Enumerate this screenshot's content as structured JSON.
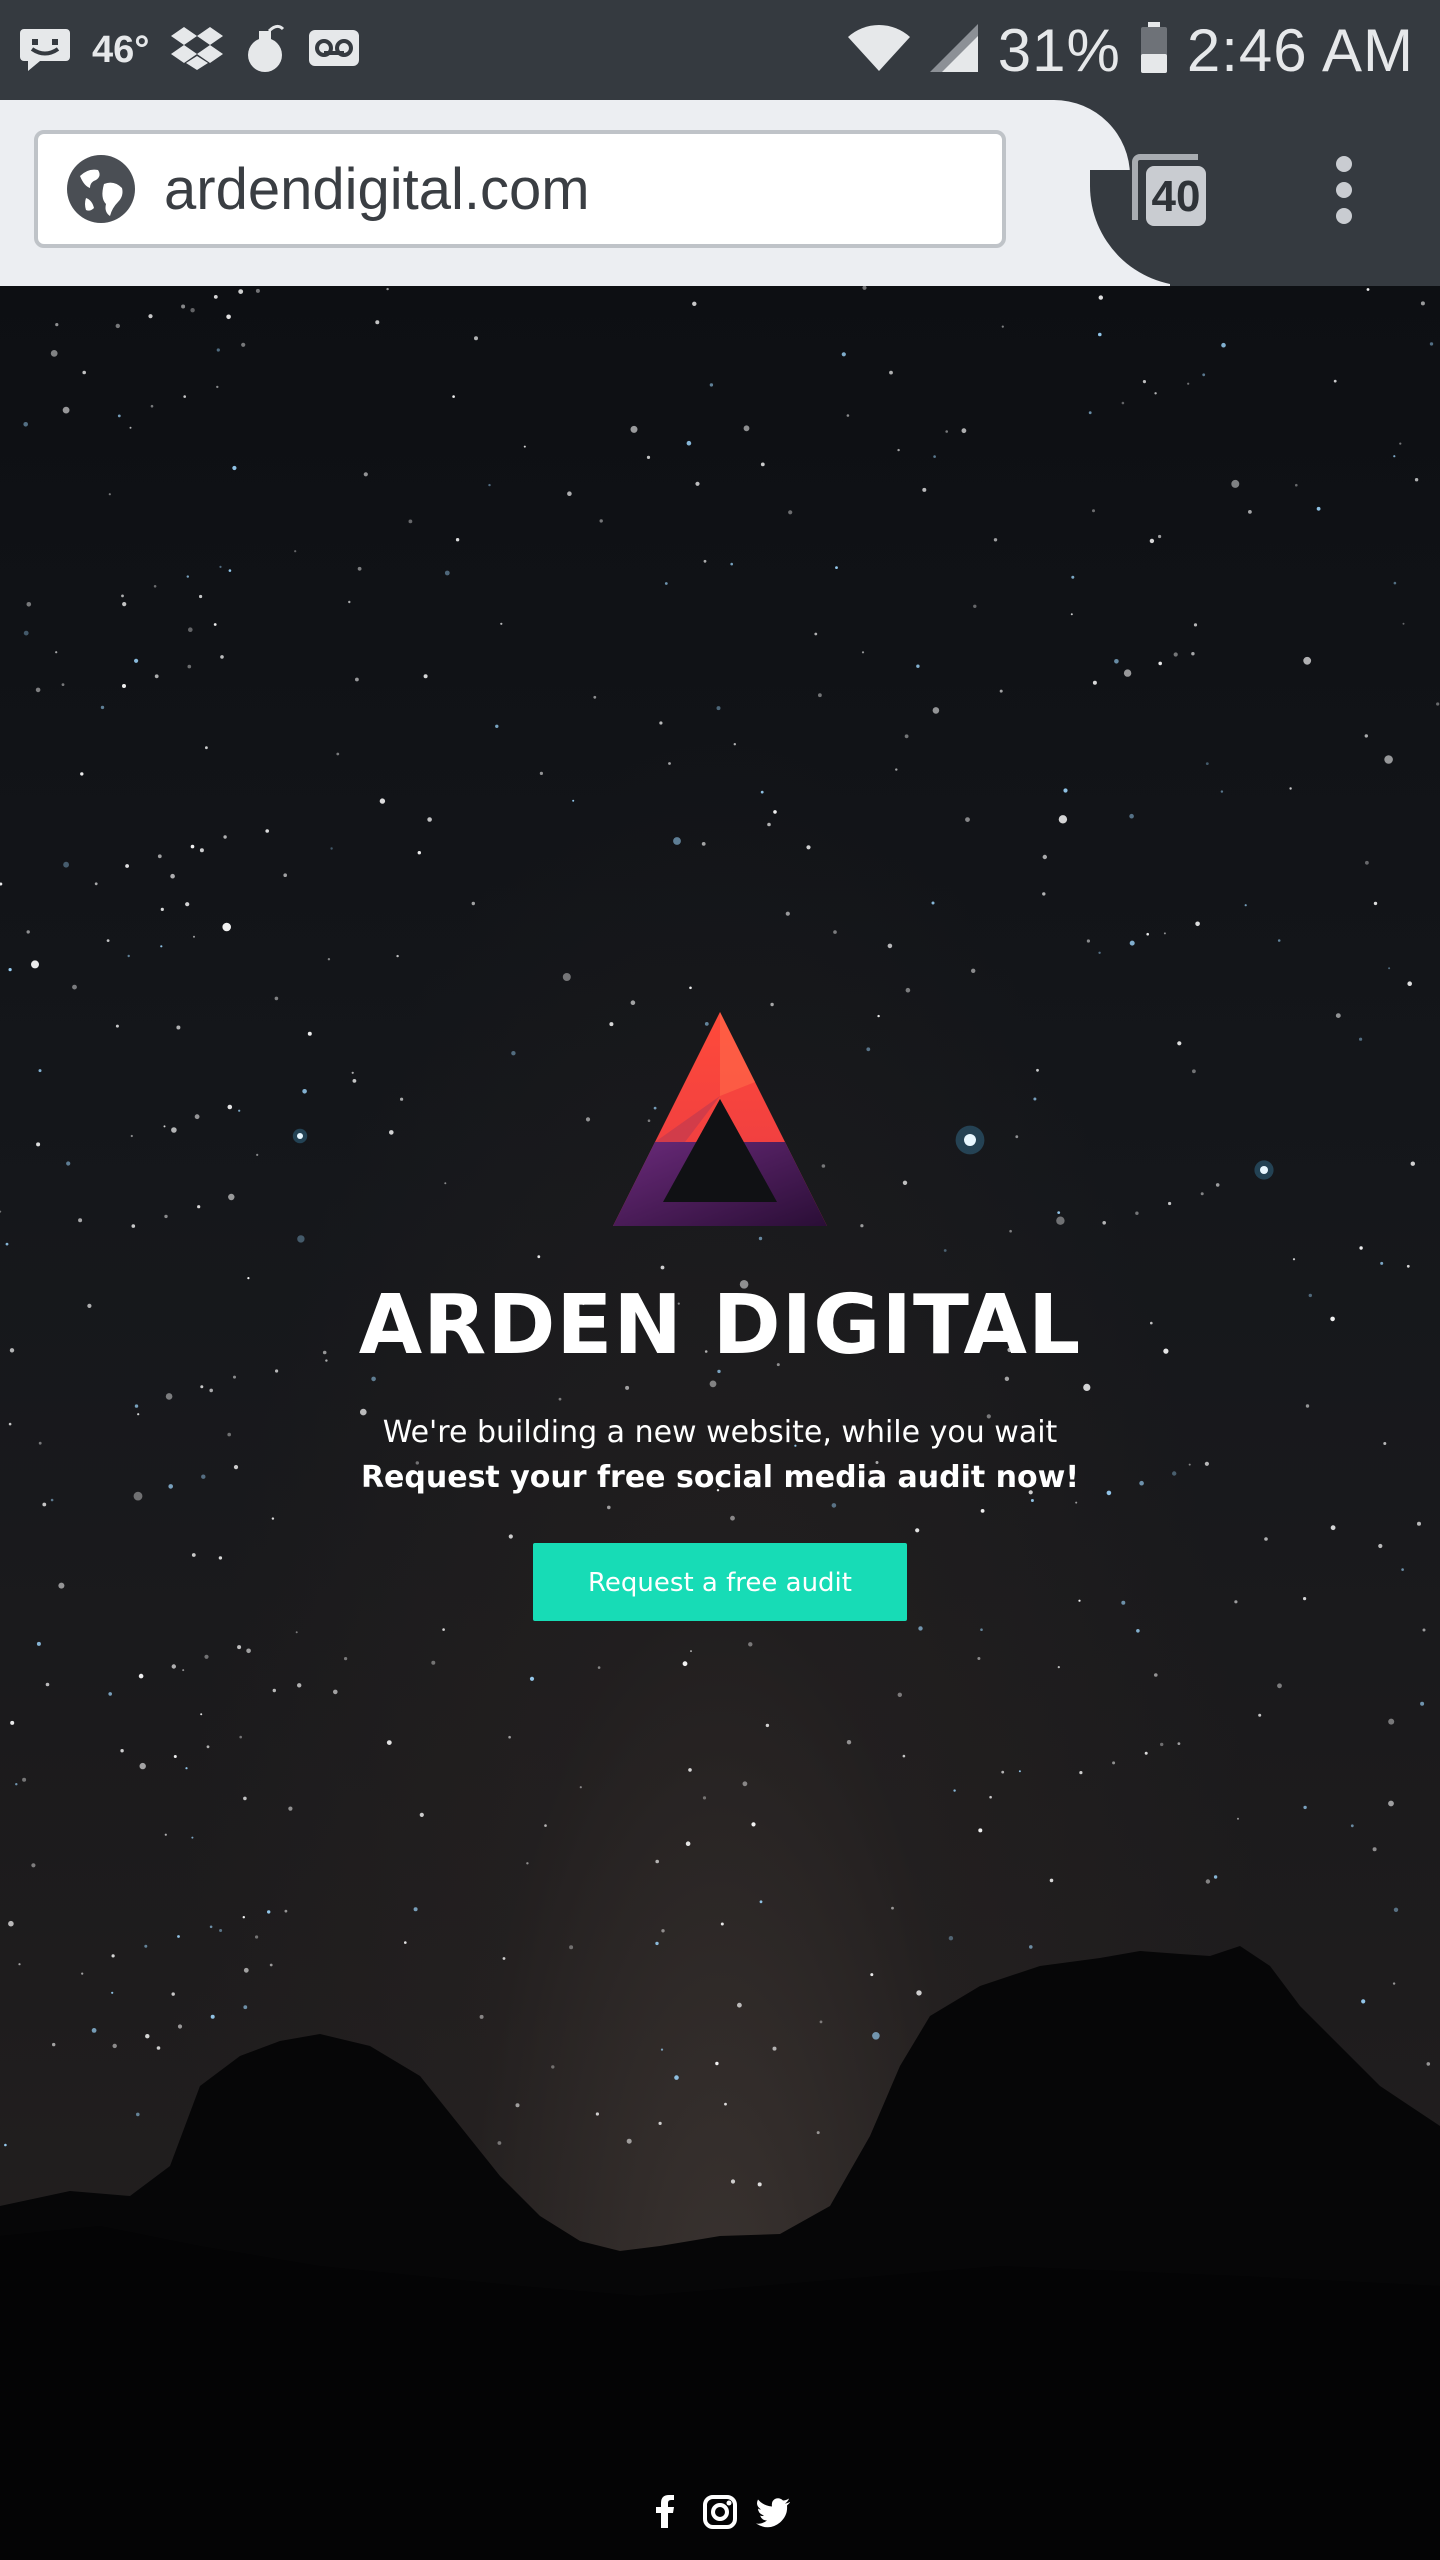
{
  "status_bar": {
    "temperature": "46°",
    "battery_percent": "31%",
    "time": "2:46 AM",
    "icons": [
      "messenger-icon",
      "dropbox-icon",
      "grenade-icon",
      "voicemail-icon",
      "wifi-icon",
      "signal-icon",
      "battery-icon"
    ]
  },
  "browser": {
    "url": "ardendigital.com",
    "tab_count": "40",
    "icons": [
      "globe-icon",
      "tabs-icon",
      "overflow-menu-icon"
    ]
  },
  "hero": {
    "brand_title": "ARDEN DIGITAL",
    "tagline": "We're building a new website, while you wait",
    "cta_text": "Request your free social media audit now!",
    "cta_button_label": "Request a free audit"
  },
  "social_links": [
    {
      "name": "facebook-icon",
      "label": "f"
    },
    {
      "name": "instagram-icon",
      "label": ""
    },
    {
      "name": "twitter-icon",
      "label": ""
    }
  ],
  "colors": {
    "status_bar_bg": "#353a40",
    "url_bar_bg": "#eceef2",
    "cta_button": "#17dcb6",
    "logo_top": "#ff4a3a",
    "logo_bottom": "#5a1e6a"
  }
}
